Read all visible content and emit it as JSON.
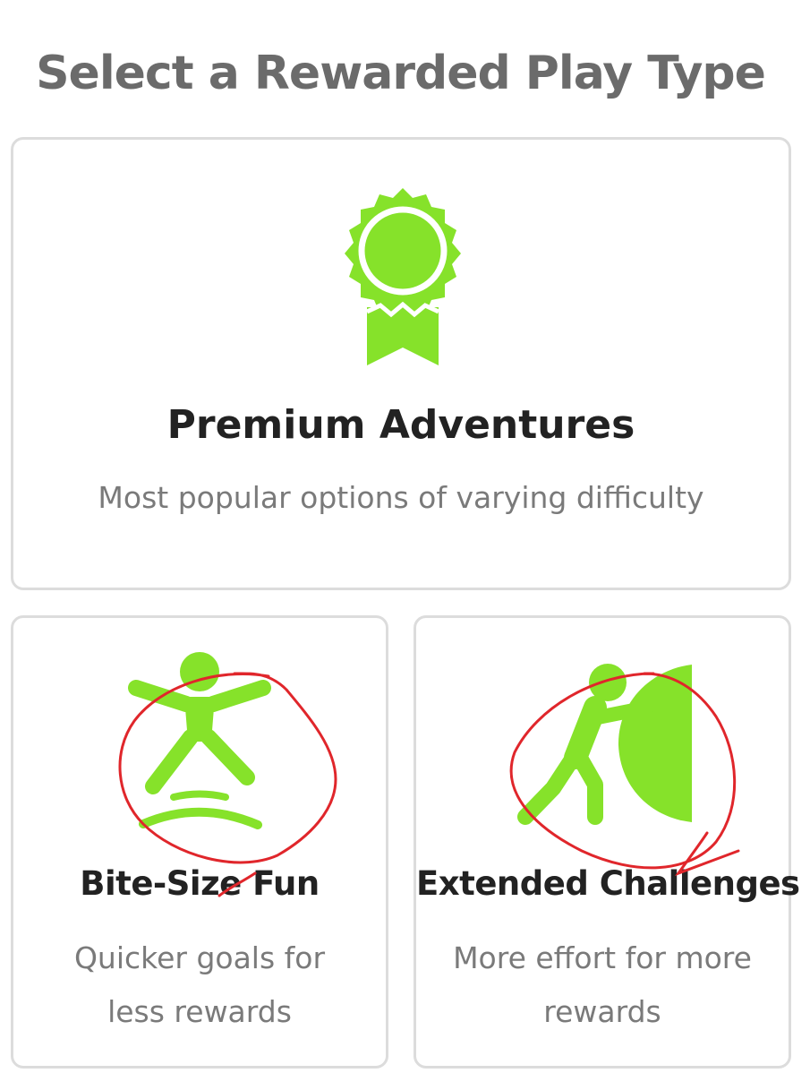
{
  "page": {
    "title": "Select a Rewarded Play Type"
  },
  "options": [
    {
      "title": "Premium Adventures",
      "description": "Most popular options of varying difficulty",
      "icon": "award-ribbon-icon"
    },
    {
      "title": "Bite-Size Fun",
      "description": "Quicker goals for less rewards",
      "icon": "jumping-person-icon"
    },
    {
      "title": "Extended Challenges",
      "description": "More effort for more rewards",
      "icon": "pushing-person-icon"
    }
  ],
  "colors": {
    "accent": "#86e22a",
    "title": "#6b6b6b",
    "card_border": "#dcdcdc",
    "annotation": "#e0262b"
  }
}
